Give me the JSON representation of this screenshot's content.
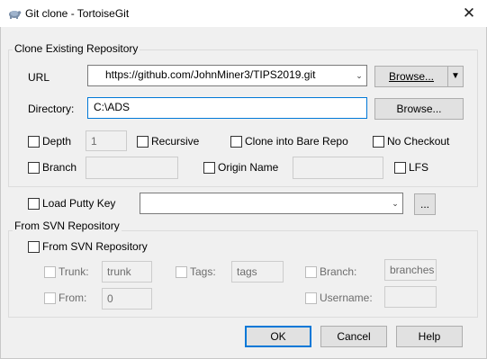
{
  "window": {
    "title": "Git clone - TortoiseGit",
    "close_glyph": "✕",
    "app_icon": "tortoisegit-icon"
  },
  "clone_group": {
    "label": "Clone Existing Repository",
    "url_label": "URL",
    "url_value": "https://github.com/JohnMiner3/TIPS2019.git",
    "url_browse": "Browse...",
    "directory_label": "Directory:",
    "directory_value": "C:\\ADS",
    "directory_browse": "Browse...",
    "depth_label": "Depth",
    "depth_value": "1",
    "recursive_label": "Recursive",
    "bare_repo_label": "Clone into Bare Repo",
    "no_checkout_label": "No Checkout",
    "branch_label": "Branch",
    "branch_value": "",
    "origin_name_label": "Origin Name",
    "origin_name_value": "",
    "lfs_label": "LFS"
  },
  "putty": {
    "label": "Load Putty Key",
    "value": "",
    "browse": "..."
  },
  "svn_group": {
    "label": "From SVN Repository",
    "from_svn_label": "From SVN Repository",
    "trunk_label": "Trunk:",
    "trunk_value": "trunk",
    "tags_label": "Tags:",
    "tags_value": "tags",
    "branch_label": "Branch:",
    "branch_value": "branches",
    "from_label": "From:",
    "from_value": "0",
    "username_label": "Username:",
    "username_value": ""
  },
  "buttons": {
    "ok": "OK",
    "cancel": "Cancel",
    "help": "Help"
  }
}
